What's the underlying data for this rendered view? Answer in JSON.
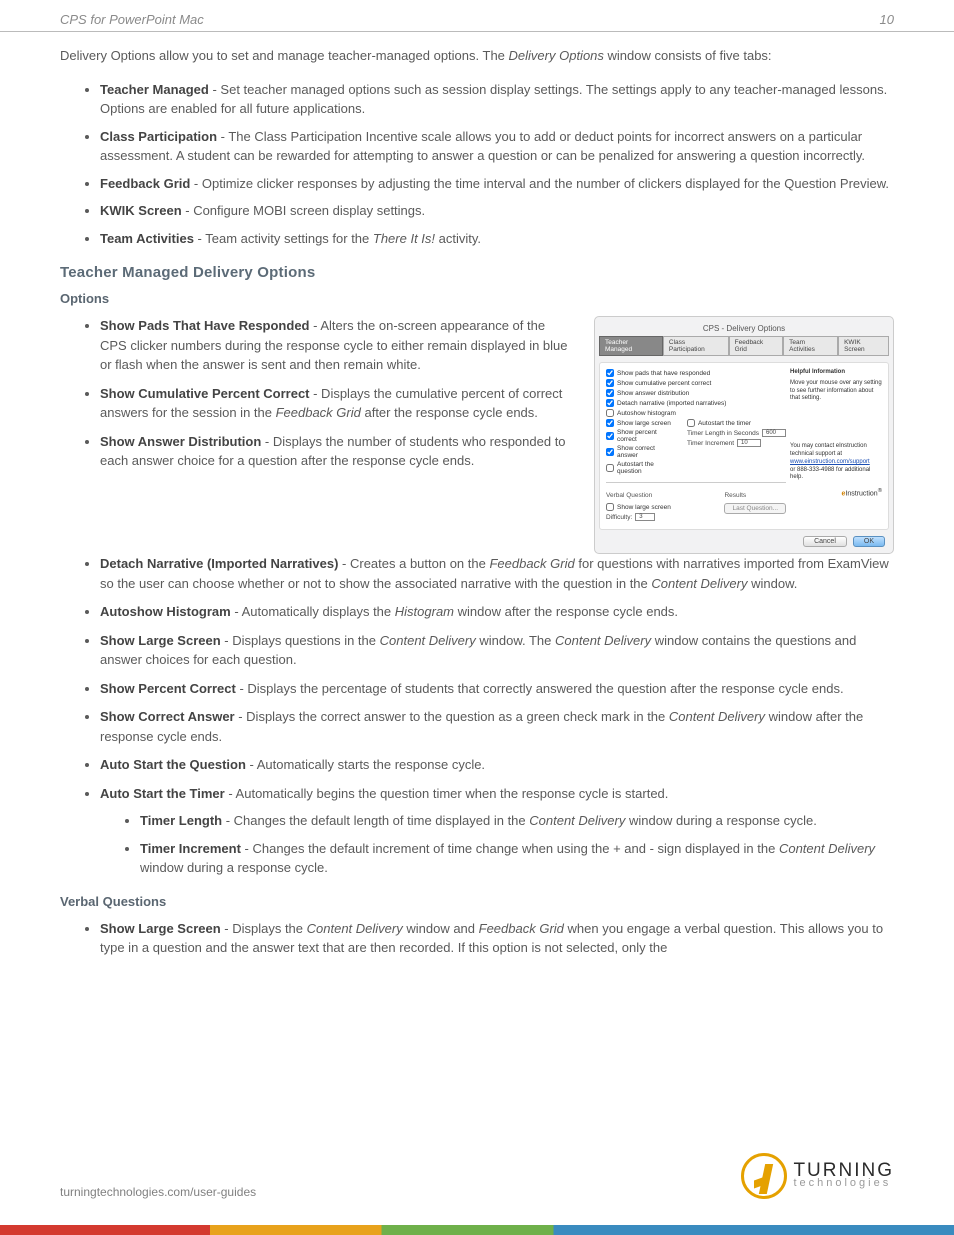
{
  "header": {
    "doc_title": "CPS for PowerPoint Mac",
    "page_num": "10"
  },
  "intro": {
    "pre": "Delivery Options allow you to set and manage teacher-managed options. The ",
    "em": "Delivery Options",
    "post": " window consists of five tabs:"
  },
  "tabs": [
    {
      "name": "Teacher Managed",
      "desc": " - Set teacher managed options such as session display settings. The settings apply to any teacher-managed lessons. Options are enabled for all future applications."
    },
    {
      "name": "Class Participation",
      "desc": " - The Class Participation Incentive scale allows you to add or deduct points for incorrect answers on a particular assessment. A student can be rewarded for attempting to answer a question or can be penalized for answering a question incorrectly."
    },
    {
      "name": "Feedback Grid",
      "desc": " - Optimize clicker responses by adjusting the time interval and the number of clickers displayed for the Question Preview."
    },
    {
      "name": "KWIK Screen",
      "desc": " - Configure MOBI screen display settings."
    },
    {
      "name": "Team Activities",
      "desc_pre": " - Team activity settings for the ",
      "desc_em": "There It Is!",
      "desc_post": " activity."
    }
  ],
  "sections": {
    "teacher_managed": "Teacher Managed Delivery Options",
    "options": "Options",
    "verbal": "Verbal Questions"
  },
  "opts_top": [
    {
      "name": "Show Pads That Have Responded",
      "desc": " - Alters the on-screen appearance of the CPS clicker numbers during the response cycle to either remain displayed in blue or flash when the answer is sent and then remain white."
    },
    {
      "name": "Show Cumulative Percent Correct",
      "desc_pre": " - Displays the cumulative percent of correct answers for the session in the ",
      "desc_em": "Feedback Grid",
      "desc_post": " after the response cycle ends."
    },
    {
      "name": "Show Answer Distribution",
      "desc": " - Displays the number of students who responded to each answer choice for a question after the response cycle ends."
    }
  ],
  "opts_bottom": [
    {
      "name": "Detach Narrative (Imported Narratives)",
      "desc_pre": " - Creates a button on the ",
      "em1": "Feedback Grid",
      "mid": " for questions with narratives imported from ExamView so the user can choose whether or not to show the associated narrative with the question in the ",
      "em2": "Content Delivery",
      "post": " window."
    },
    {
      "name": "Autoshow Histogram",
      "desc_pre": " - Automatically displays the ",
      "em1": "Histogram",
      "post": " window after the response cycle ends."
    },
    {
      "name": "Show Large Screen",
      "desc_pre": " - Displays questions in the ",
      "em1": "Content Delivery",
      "mid": " window. The ",
      "em2": "Content Delivery",
      "post": " window contains the questions and answer choices for each question."
    },
    {
      "name": "Show Percent Correct",
      "desc": " - Displays the percentage of students that correctly answered the question after the response cycle ends."
    },
    {
      "name": "Show Correct Answer",
      "desc_pre": " - Displays the correct answer to the question as a green check mark in the ",
      "em1": "Content Delivery",
      "post": " window after the response cycle ends."
    },
    {
      "name": "Auto Start the Question",
      "desc": " - Automatically starts the response cycle."
    },
    {
      "name": "Auto Start the Timer",
      "desc": " - Automatically begins the question timer when the response cycle is started.",
      "children": [
        {
          "name": "Timer Length",
          "desc_pre": " - Changes the default length of time displayed in the ",
          "em1": "Content Delivery",
          "post": " window during a response cycle."
        },
        {
          "name": "Timer Increment",
          "desc_pre": " - Changes the default increment of time change when using the + and - sign displayed in the ",
          "em1": "Content Delivery",
          "post": " window during a response cycle."
        }
      ]
    }
  ],
  "verbal": [
    {
      "name": "Show Large Screen",
      "desc_pre": " - Displays the ",
      "em1": "Content Delivery",
      "mid": " window and ",
      "em2": "Feedback Grid",
      "post": " when you engage a verbal question. This allows you to type in a question and the answer text that are then recorded. If this option is not selected, only the"
    }
  ],
  "screenshot": {
    "window_title": "CPS - Delivery Options",
    "tabs": [
      "Teacher Managed",
      "Class Participation",
      "Feedback Grid",
      "Team Activities",
      "KWIK Screen"
    ],
    "checks_left": [
      {
        "label": "Show pads that have responded",
        "checked": true
      },
      {
        "label": "Show cumulative percent correct",
        "checked": true
      },
      {
        "label": "Show answer distribution",
        "checked": true
      },
      {
        "label": "Detach narrative (imported narratives)",
        "checked": true
      },
      {
        "label": "Autoshow histogram",
        "checked": false
      },
      {
        "label": "Show large screen",
        "checked": true
      },
      {
        "label": "Show percent correct",
        "checked": true
      },
      {
        "label": "Show correct answer",
        "checked": true
      },
      {
        "label": "Autostart the question",
        "checked": false
      }
    ],
    "checks_right": [
      {
        "label": "Autostart the timer",
        "checked": false
      }
    ],
    "timer_length_label": "Timer Length in Seconds",
    "timer_length_value": "600",
    "timer_increment_label": "Timer Increment",
    "timer_increment_value": "10",
    "help_header": "Helpful Information",
    "help_text": "Move your mouse over any setting to see further information about that setting.",
    "support_text": "You may contact eInstruction technical support at",
    "support_link": "www.einstruction.com/support",
    "support_phone": "or 888-333-4988 for additional help.",
    "brand": "eInstruction",
    "verbal_header": "Verbal Question",
    "results_header": "Results",
    "verbal_show_large": "Show large screen",
    "last_question_btn": "Last Question...",
    "difficulty_label": "Difficulty:",
    "difficulty_value": "3",
    "cancel": "Cancel",
    "ok": "OK"
  },
  "footer": {
    "link": "turningtechnologies.com/user-guides",
    "logo_line1": "TURNING",
    "logo_line2": "technologies"
  }
}
